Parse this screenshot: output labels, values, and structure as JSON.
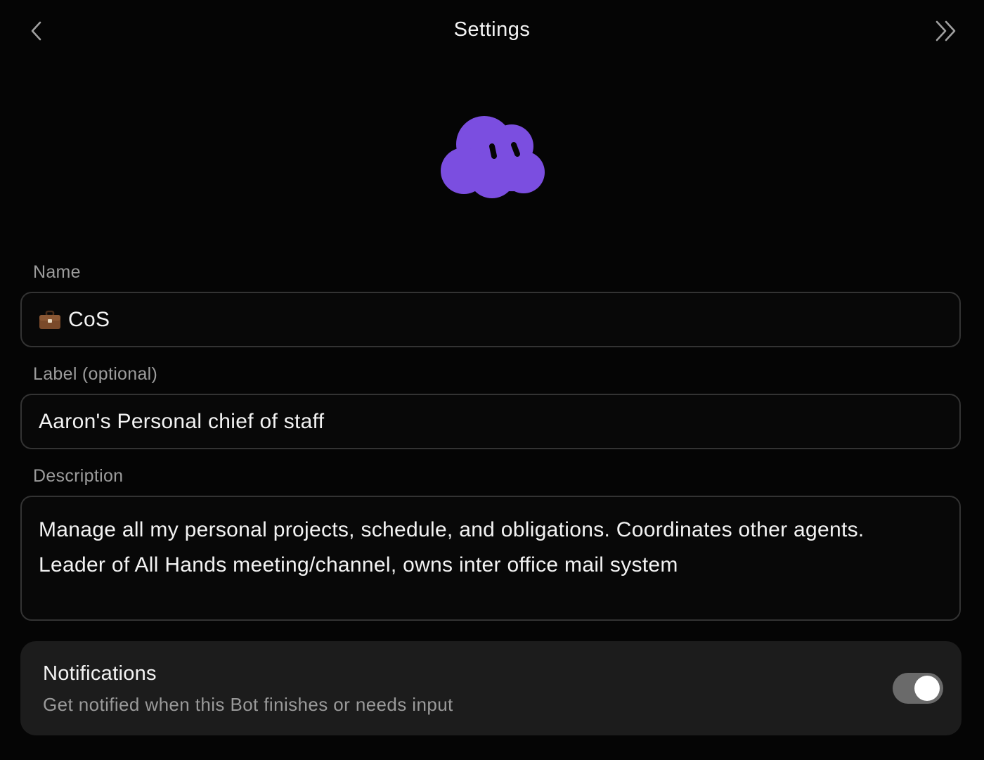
{
  "header": {
    "title": "Settings",
    "back_icon": "chevron-left-icon",
    "collapse_icon": "double-chevron-right-icon"
  },
  "avatar": {
    "icon": "cloud-mascot-icon",
    "color": "#7b4ee0"
  },
  "fields": {
    "name": {
      "label": "Name",
      "emoji_icon": "briefcase-icon",
      "value": "CoS"
    },
    "label": {
      "label": "Label (optional)",
      "value": "Aaron's Personal chief of staff"
    },
    "description": {
      "label": "Description",
      "line1": "Manage all my personal projects, schedule, and obligations. Coordinates other agents.",
      "line2": "Leader of All Hands meeting/channel, owns inter office mail system"
    }
  },
  "notifications": {
    "title": "Notifications",
    "subtitle": "Get notified when this Bot finishes or needs input",
    "enabled": true
  }
}
